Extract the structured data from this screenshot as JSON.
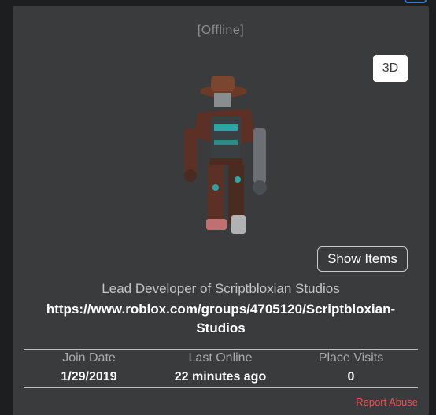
{
  "profile": {
    "status": "[Offline]",
    "view_toggle": "3D",
    "show_items_label": "Show Items",
    "blurb_title": "Lead Developer of Scriptbloxian Studios",
    "blurb_link_line1": "https://www.roblox.com/groups/4705120/Scriptbloxian-",
    "blurb_link_line2": "Studios"
  },
  "stats": [
    {
      "label": "Join Date",
      "value": "1/29/2019"
    },
    {
      "label": "Last Online",
      "value": "22 minutes ago"
    },
    {
      "label": "Place Visits",
      "value": "0"
    }
  ],
  "report_label": "Report Abuse",
  "colors": {
    "background": "#1d1e1f",
    "panel": "#393b3d",
    "report": "#e2554e",
    "accent": "#3a7bbf"
  },
  "icons": {
    "corner": "menu-icon"
  }
}
